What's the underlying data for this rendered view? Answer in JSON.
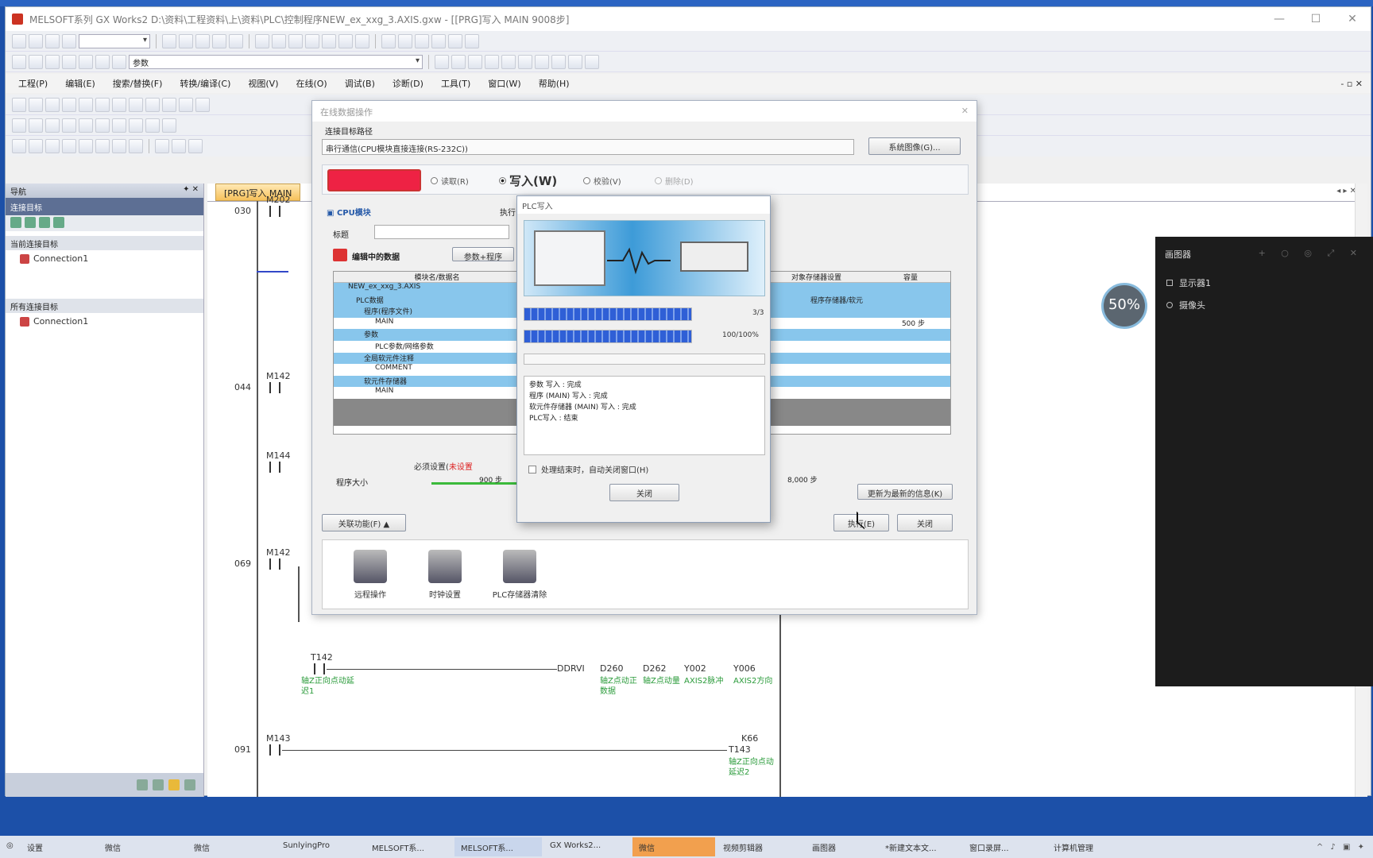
{
  "window": {
    "title": "MELSOFT系列 GX Works2 D:\\资料\\工程资料\\上\\资料\\PLC\\控制程序NEW_ex_xxg_3.AXIS.gxw - [[PRG]写入 MAIN 9008步]",
    "controls": [
      "—",
      "☐",
      "✕"
    ]
  },
  "toolbar": {
    "combo_label": "参数",
    "combo2_label": ""
  },
  "menu": {
    "items": [
      "工程(P)",
      "编辑(E)",
      "搜索/替换(F)",
      "转换/编译(C)",
      "视图(V)",
      "在线(O)",
      "调试(B)",
      "诊断(D)",
      "工具(T)",
      "窗口(W)",
      "帮助(H)"
    ],
    "mdi_controls": "- ▫ ✕"
  },
  "nav": {
    "title": "导航",
    "pin": "✦ ✕",
    "section": "连接目标",
    "current_group": "当前连接目标",
    "all_group": "所有连接目标",
    "connection1": "Connection1",
    "connection2": "Connection1"
  },
  "ladder": {
    "tab": "[PRG]写入 MAIN",
    "tab_ctrl": "◂ ▸ ✕",
    "rows": [
      {
        "no": "030",
        "label": "M202"
      },
      {
        "no": "044",
        "label": "M142"
      },
      {
        "no": "",
        "label": "M144"
      },
      {
        "no": "069",
        "label": "M142"
      },
      {
        "no": "091",
        "label": "M143"
      }
    ],
    "rung4": {
      "contact": "T142",
      "contact_comment": "轴Z正向点动延迟1",
      "instr": "DDRVI",
      "ops": [
        "D260",
        "D262",
        "Y002",
        "Y006"
      ],
      "op_comments": [
        "轴Z点动正数据",
        "轴Z点动量",
        "AXIS2脉冲",
        "AXIS2方向"
      ]
    },
    "rung5": {
      "coil": "T143",
      "coil_label": "K66",
      "coil_comment": "轴Z正向点动延迟2"
    }
  },
  "dialog": {
    "title": "在线数据操作",
    "path_group": "连接目标路径",
    "path": "串行通信(CPU模块直接连接(RS-232C))",
    "sysimg_btn": "系统图像(G)...",
    "modes": [
      {
        "label": "读取(R)",
        "selected": false
      },
      {
        "label": "写入(W)",
        "selected": true
      },
      {
        "label": "校验(V)",
        "selected": false
      },
      {
        "label": "删除(D)",
        "selected": false
      }
    ],
    "tab_cpu": "CPU模块",
    "tab_exec": "执行",
    "title_field_label": "标题",
    "editing_data": "编辑中的数据",
    "param_btn": "参数+程序",
    "columns": [
      "模块名/数据名",
      "",
      "对象存储器设置",
      "容量"
    ],
    "tree": [
      {
        "label": "NEW_ex_xxg_3.AXIS",
        "hl": true,
        "right": ""
      },
      {
        "label": "PLC数据",
        "hl": true,
        "right": "程序存储器/软元"
      },
      {
        "label": "程序(程序文件)",
        "hl": true,
        "right": ""
      },
      {
        "label": "MAIN",
        "hl": false,
        "right": "500 步"
      },
      {
        "label": "参数",
        "hl": true,
        "right": ""
      },
      {
        "label": "PLC参数/网络参数",
        "hl": false,
        "right": ""
      },
      {
        "label": "全局软元件注释",
        "hl": true,
        "right": ""
      },
      {
        "label": "COMMENT",
        "hl": false,
        "right": ""
      },
      {
        "label": "软元件存储器",
        "hl": true,
        "right": ""
      },
      {
        "label": "MAIN",
        "hl": false,
        "right": ""
      }
    ],
    "req_label": "必须设置(",
    "req_value": "未设置",
    "size_label": "程序大小",
    "size_used": "900 步",
    "size_max": "8,000 步",
    "refresh_btn": "更新为最新的信息(K)",
    "related_btn": "关联功能(F) ▲",
    "exec_btn": "执行(E)",
    "close_btn": "关闭",
    "funcs": [
      "远程操作",
      "时钟设置",
      "PLC存储器清除"
    ]
  },
  "progress": {
    "title": "PLC写入",
    "bar1_label": "3/3",
    "bar1_value": 1.0,
    "bar2_label": "100/100%",
    "bar2_value": 1.0,
    "log": [
      "参数 写入 : 完成",
      "程序 (MAIN) 写入 : 完成",
      "软元件存储器 (MAIN) 写入 : 完成",
      "PLC写入 : 结束"
    ],
    "auto_close": "处理结束时，自动关闭窗口(H)",
    "close_btn": "关闭"
  },
  "ring": {
    "value": "50%"
  },
  "dark_panel": {
    "title": "画图器",
    "controls": "+ ○ ◎ ⤢ ✕",
    "items": [
      "显示器1",
      "摄像头"
    ]
  },
  "taskbar": {
    "items": [
      "设置",
      "微信",
      "微信",
      "SunlyingPro",
      "MELSOFT系...",
      "MELSOFT系...",
      "GX Works2...",
      "微信",
      "视频剪辑器",
      "画图器",
      "*新建文本文...",
      "窗口录屏...",
      "计算机管理"
    ],
    "tray": "^ ♪ ▣ ✦"
  },
  "colors": {
    "desktop": "#1c50a8",
    "highlight": "#88c6ec",
    "progress": "#2f5fd6",
    "comment": "#2a9b3a"
  }
}
